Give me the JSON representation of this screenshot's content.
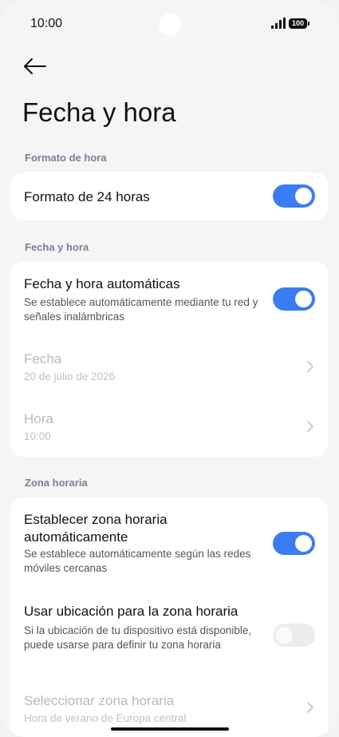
{
  "status_bar": {
    "time": "10:00",
    "battery": "100"
  },
  "header": {
    "title": "Fecha y hora"
  },
  "sections": {
    "time_format": {
      "label": "Formato de hora",
      "format24": {
        "title": "Formato de 24 horas",
        "enabled": true
      }
    },
    "date_time": {
      "label": "Fecha y hora",
      "auto": {
        "title": "Fecha y hora automáticas",
        "subtitle": "Se establece automáticamente mediante tu red y señales inalámbricas",
        "enabled": true
      },
      "date": {
        "title": "Fecha",
        "value": "20 de julio de 2026"
      },
      "time": {
        "title": "Hora",
        "value": "10:00"
      }
    },
    "timezone": {
      "label": "Zona horaria",
      "auto_zone": {
        "title": "Establecer zona horaria automáticamente",
        "subtitle": "Se establece automáticamente según las redes móviles cercanas",
        "enabled": true
      },
      "use_location": {
        "title": "Usar ubicación para la zona horaria",
        "subtitle": "Si la ubicación de tu dispositivo está disponible, puede usarse para definir tu zona horaria",
        "enabled": false
      },
      "select_zone": {
        "title": "Seleccionar zona horaria",
        "value": "Hora de verano de Europa central"
      }
    }
  },
  "colors": {
    "accent": "#3a7df2",
    "section_label": "#7a7f98",
    "background": "#f5f5f5"
  },
  "icons": {
    "back": "arrow-left-icon",
    "chevron": "chevron-right-icon"
  }
}
